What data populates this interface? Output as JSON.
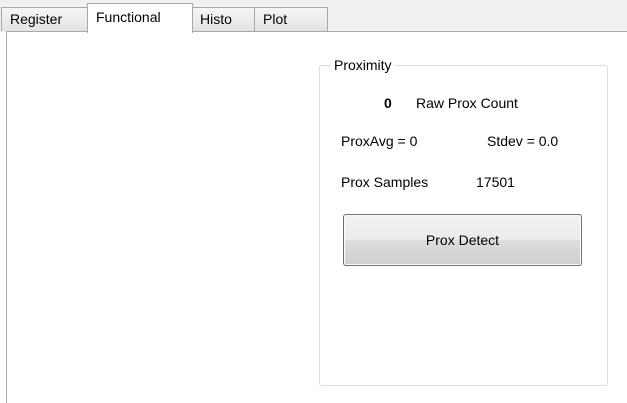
{
  "tabs": [
    {
      "label": "Register"
    },
    {
      "label": "Functional"
    },
    {
      "label": "Histo"
    },
    {
      "label": "Plot"
    }
  ],
  "active_tab": "Functional",
  "proximity": {
    "group_title": "Proximity",
    "raw_count_value": "0",
    "raw_count_label": "Raw Prox Count",
    "prox_avg_text": "ProxAvg = 0",
    "stdev_text": "Stdev = 0.0",
    "samples_label": "Prox Samples",
    "samples_value": "17501",
    "detect_button_label": "Prox Detect"
  }
}
